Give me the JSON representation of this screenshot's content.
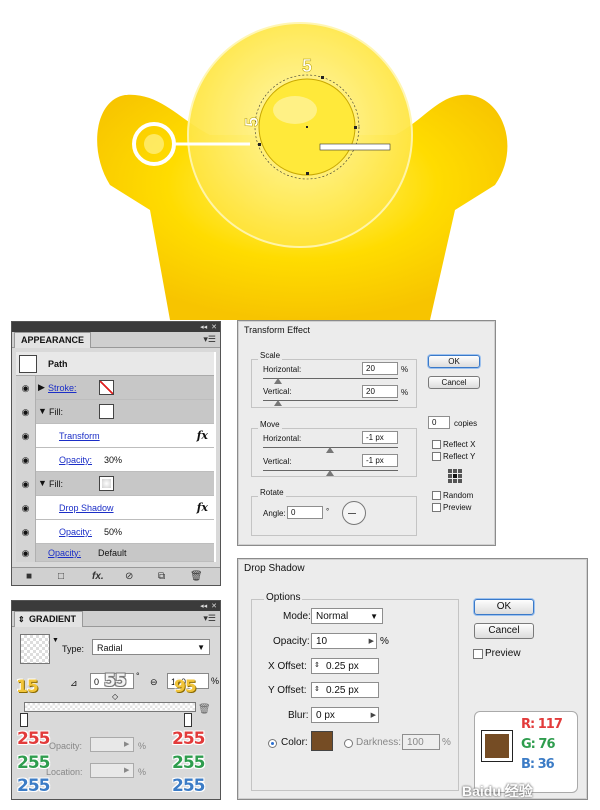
{
  "appearance": {
    "panel_title": "APPEARANCE",
    "object": "Path",
    "stroke_label": "Stroke:",
    "fill_label": "Fill:",
    "fill2_label": "Fill:",
    "transform_label": "Transform",
    "opacity1_label": "Opacity:",
    "opacity1_value": "30%",
    "drop_shadow_label": "Drop Shadow",
    "opacity2_label": "Opacity:",
    "opacity2_value": "50%",
    "opacity_default_label": "Opacity:",
    "opacity_default_value": "Default",
    "fx": "fx"
  },
  "gradient": {
    "panel_title": "GRADIENT",
    "type_label": "Type:",
    "type_value": "Radial",
    "angle_value": "0",
    "aspect_value": "100",
    "pct": "%",
    "deg": "°",
    "opacity_label": "Opacity:",
    "location_label": "Location:",
    "overlay_15": "15",
    "overlay_55": "55",
    "overlay_95": "95",
    "left_r": "255",
    "left_g": "255",
    "left_b": "255",
    "right_r": "255",
    "right_g": "255",
    "right_b": "255"
  },
  "transform": {
    "title": "Transform Effect",
    "scale_label": "Scale",
    "horizontal_label": "Horizontal:",
    "scale_h": "20",
    "vertical_label": "Vertical:",
    "scale_v": "20",
    "pct": "%",
    "move_label": "Move",
    "move_h_label": "Horizontal:",
    "move_h": "-1 px",
    "move_v_label": "Vertical:",
    "move_v": "-1 px",
    "rotate_label": "Rotate",
    "angle_label": "Angle:",
    "angle_value": "0",
    "deg": "°",
    "ok": "OK",
    "cancel": "Cancel",
    "copies_value": "0",
    "copies_label": "copies",
    "reflect_x": "Reflect X",
    "reflect_y": "Reflect Y",
    "random": "Random",
    "preview": "Preview"
  },
  "drop_shadow": {
    "title": "Drop Shadow",
    "options_label": "Options",
    "mode_label": "Mode:",
    "mode_value": "Normal",
    "opacity_label": "Opacity:",
    "opacity_value": "10",
    "pct": "%",
    "x_label": "X Offset:",
    "x_value": "0.25 px",
    "y_label": "Y Offset:",
    "y_value": "0.25 px",
    "blur_label": "Blur:",
    "blur_value": "0 px",
    "color_label": "Color:",
    "darkness_label": "Darkness:",
    "darkness_value": "100",
    "ok": "OK",
    "cancel": "Cancel",
    "preview": "Preview",
    "r_label": "R: 117",
    "g_label": "G: 76",
    "b_label": "B: 36"
  },
  "illustration": {
    "dim_top": "5",
    "dim_left": "5"
  },
  "colors": {
    "yellow": "#ffd900",
    "shadow_color": "#754c24"
  },
  "watermark": "Baidu 经验"
}
